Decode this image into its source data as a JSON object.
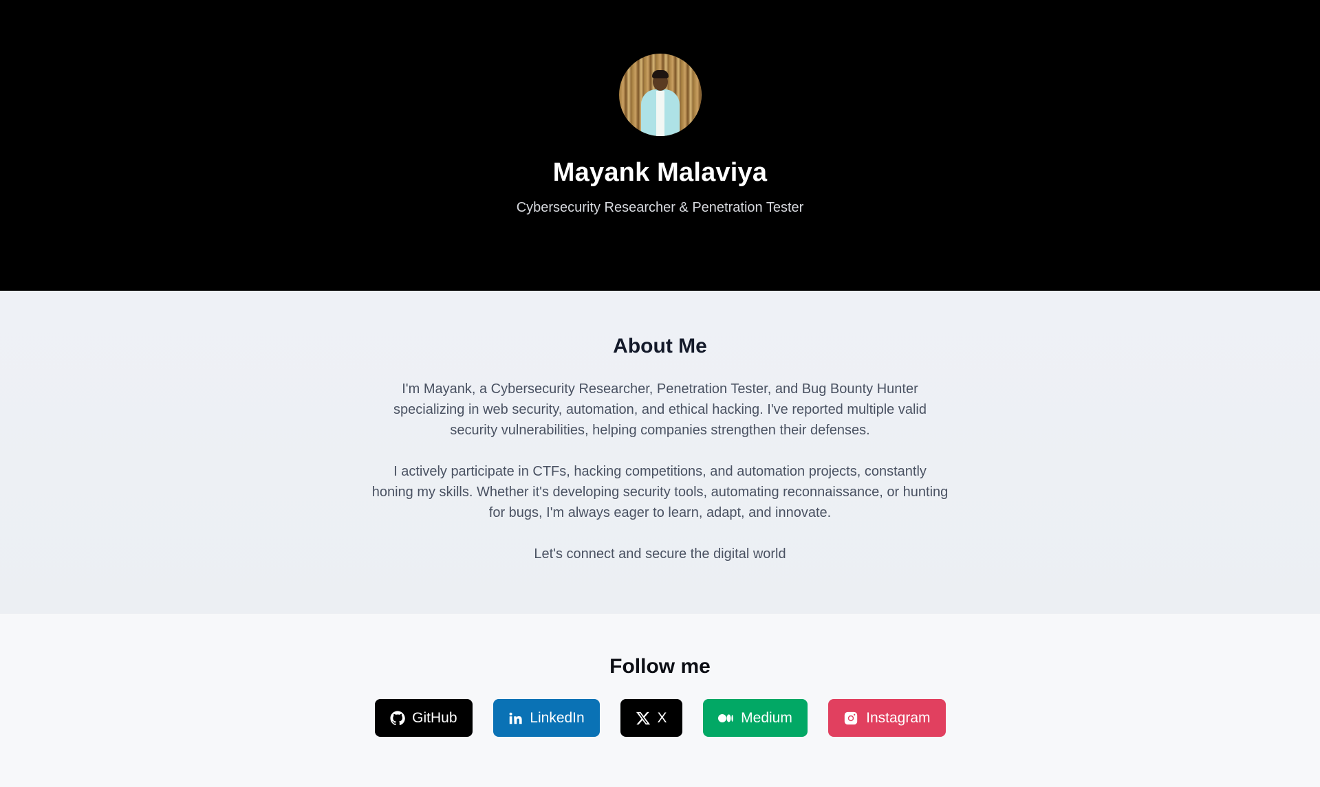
{
  "hero": {
    "name": "Mayank Malaviya",
    "tagline": "Cybersecurity Researcher & Penetration Tester",
    "avatar_icon": "profile-photo"
  },
  "about": {
    "title": "About Me",
    "paragraphs": [
      "I'm Mayank, a Cybersecurity Researcher, Penetration Tester, and Bug Bounty Hunter specializing in web security, automation, and ethical hacking. I've reported multiple valid security vulnerabilities, helping companies strengthen their defenses.",
      "I actively participate in CTFs, hacking competitions, and automation projects, constantly honing my skills. Whether it's developing security tools, automating reconnaissance, or hunting for bugs, I'm always eager to learn, adapt, and innovate.",
      "Let's connect and secure the digital world"
    ]
  },
  "follow": {
    "title": "Follow me",
    "links": [
      {
        "label": "GitHub",
        "icon": "github-icon",
        "color": "#000000"
      },
      {
        "label": "LinkedIn",
        "icon": "linkedin-icon",
        "color": "#0a72b5"
      },
      {
        "label": "X",
        "icon": "x-icon",
        "color": "#000000"
      },
      {
        "label": "Medium",
        "icon": "medium-icon",
        "color": "#02a865"
      },
      {
        "label": "Instagram",
        "icon": "instagram-icon",
        "color": "#e1405f"
      }
    ]
  },
  "colors": {
    "hero_bg": "#000000",
    "about_bg": "#eef1f6",
    "follow_bg": "#f7f8fa"
  }
}
